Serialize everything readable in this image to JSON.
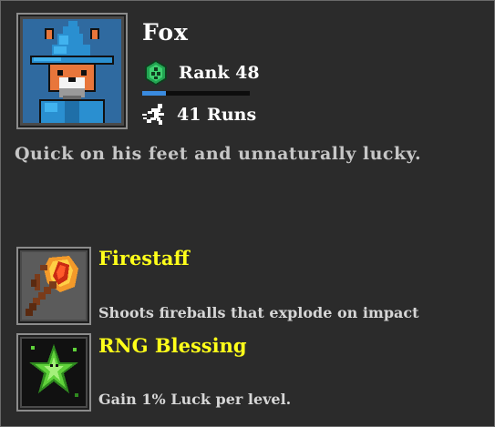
{
  "character": {
    "name": "Fox",
    "rank_label": "Rank 48",
    "rank_progress": 0.22,
    "runs_label": "41 Runs",
    "description": "Quick on his feet and unnaturally lucky.",
    "portrait_icon": "fox-wizard-portrait",
    "rank_icon": "green-rank-badge-icon",
    "runs_icon": "running-person-icon"
  },
  "items": [
    {
      "title": "Firestaff",
      "description": "Shoots fireballs that explode on impact",
      "icon": "firestaff-icon"
    },
    {
      "title": "RNG Blessing",
      "description": "Gain 1% Luck per level.",
      "icon": "green-star-blessing-icon"
    }
  ],
  "colors": {
    "background": "#2b2b2b",
    "item_title": "#ffff1a",
    "rank_bar_fill": "#3a8be0",
    "rank_badge": "#22a552"
  }
}
